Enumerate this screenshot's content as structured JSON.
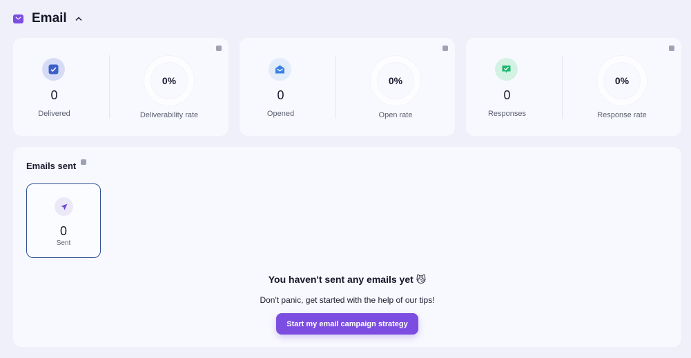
{
  "header": {
    "title": "Email",
    "icon": "mail-icon",
    "chevron": "chevron-up-icon",
    "accent": "#7b4de0"
  },
  "cards": [
    {
      "icon": "check-square-icon",
      "icon_bg": "#d6dcf6",
      "icon_fg": "#3d5fc9",
      "count": "0",
      "count_label": "Delivered",
      "rate": "0%",
      "rate_label": "Deliverability rate"
    },
    {
      "icon": "envelope-open-icon",
      "icon_bg": "#e2ecfb",
      "icon_fg": "#3b82e0",
      "count": "0",
      "count_label": "Opened",
      "rate": "0%",
      "rate_label": "Open rate"
    },
    {
      "icon": "reply-check-icon",
      "icon_bg": "#d3f2e3",
      "icon_fg": "#1eb66f",
      "count": "0",
      "count_label": "Responses",
      "rate": "0%",
      "rate_label": "Response rate"
    }
  ],
  "emails_sent": {
    "title": "Emails sent",
    "tile": {
      "icon": "paper-plane-icon",
      "count": "0",
      "label": "Sent"
    },
    "empty_title": "You haven't sent any emails yet 😼",
    "empty_subtitle": "Don't panic, get started with the help of our tips!",
    "cta_label": "Start my email campaign strategy"
  }
}
